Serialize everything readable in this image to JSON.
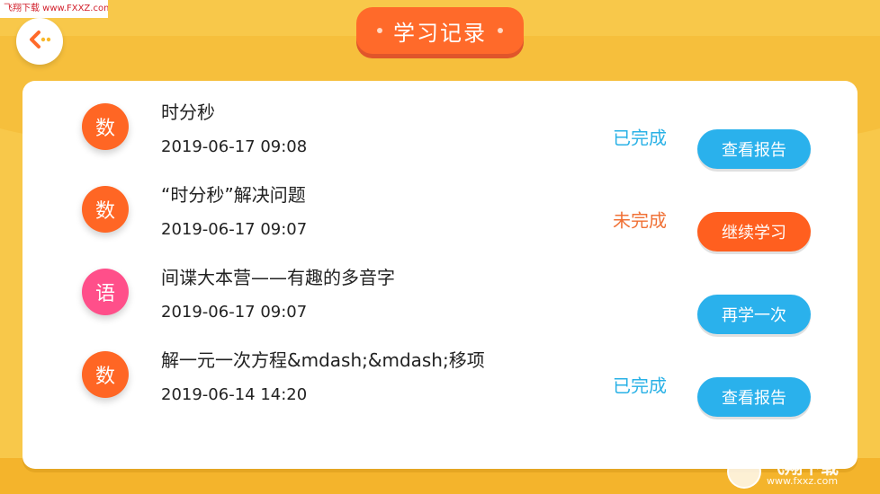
{
  "watermark_top": "飞翔下载 www.FXXZ.com",
  "header": {
    "title": "学习记录"
  },
  "records": [
    {
      "avatar_char": "数",
      "avatar_color": "#ff6624",
      "title": "时分秒",
      "time": "2019-06-17 09:08",
      "status": "已完成",
      "status_color": "#29b1e6",
      "button": "查看报告",
      "button_color": "#2ab1ec"
    },
    {
      "avatar_char": "数",
      "avatar_color": "#ff6624",
      "title": "“时分秒”解决问题",
      "time": "2019-06-17 09:07",
      "status": "未完成",
      "status_color": "#f07136",
      "button": "继续学习",
      "button_color": "#ff5f1f"
    },
    {
      "avatar_char": "语",
      "avatar_color": "#ff4f8a",
      "title": "间谍大本营——有趣的多音字",
      "time": "2019-06-17 09:07",
      "status": "",
      "status_color": "#29b1e6",
      "button": "再学一次",
      "button_color": "#2ab1ec"
    },
    {
      "avatar_char": "数",
      "avatar_color": "#ff6624",
      "title": "解一元一次方程&mdash;&mdash;移项",
      "time": "2019-06-14 14:20",
      "status": "已完成",
      "status_color": "#29b1e6",
      "button": "查看报告",
      "button_color": "#2ab1ec"
    }
  ],
  "watermark_bottom": {
    "name": "飞翔下载",
    "url": "www.fxxz.com"
  },
  "icons": {
    "back": "back-arrow-icon"
  }
}
